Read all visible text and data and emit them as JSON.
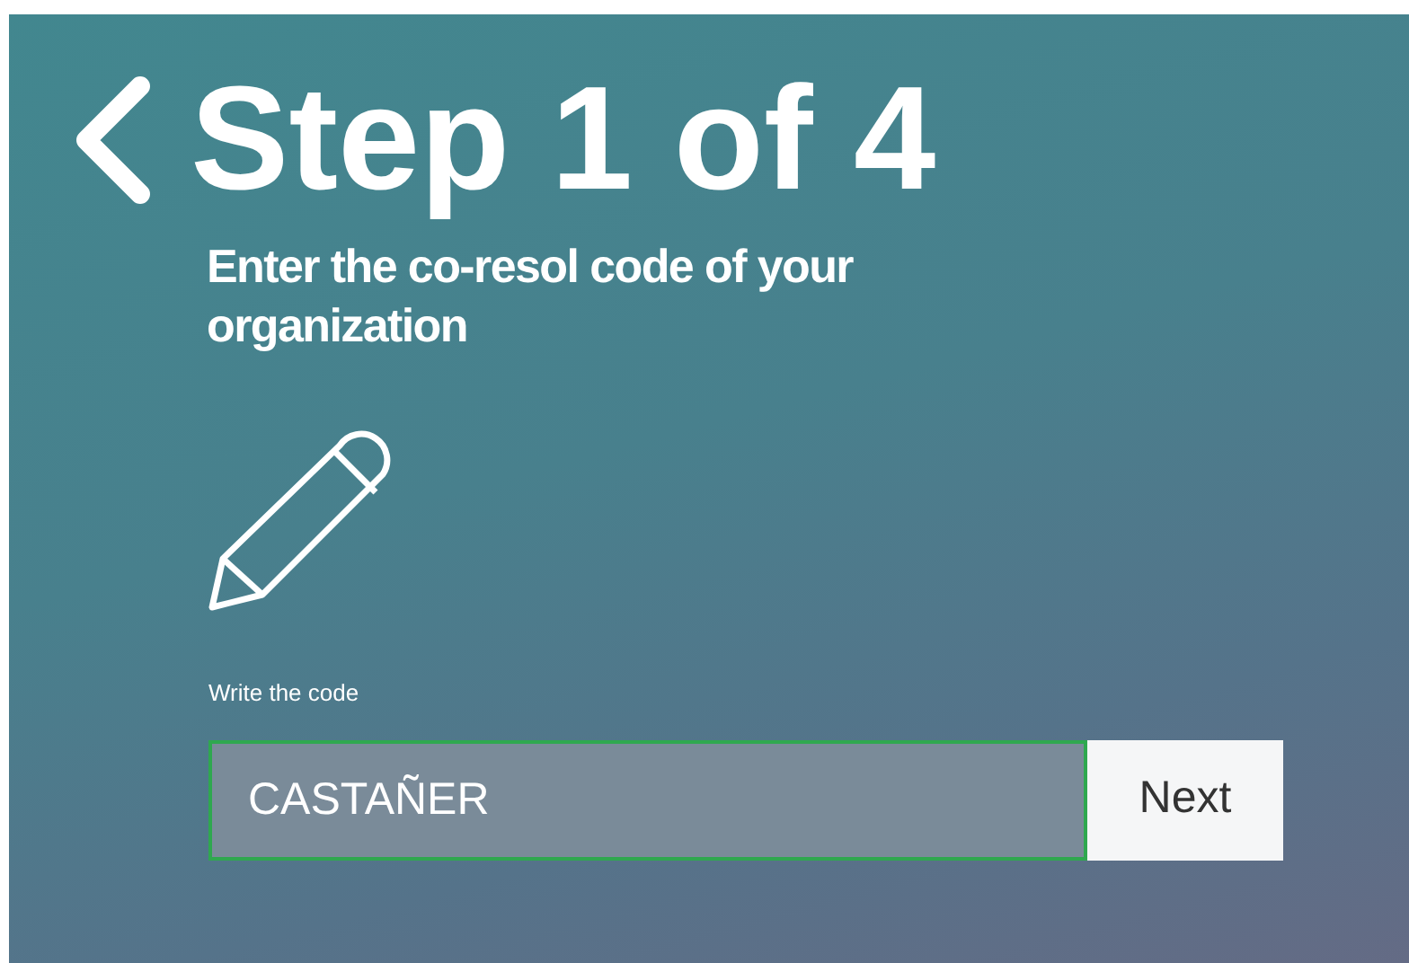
{
  "header": {
    "title": "Step 1 of 4"
  },
  "subtitle": "Enter the co-resol code of your organization",
  "code_field": {
    "label": "Write the code",
    "value": "CASTAÑER"
  },
  "buttons": [
    "Next"
  ]
}
